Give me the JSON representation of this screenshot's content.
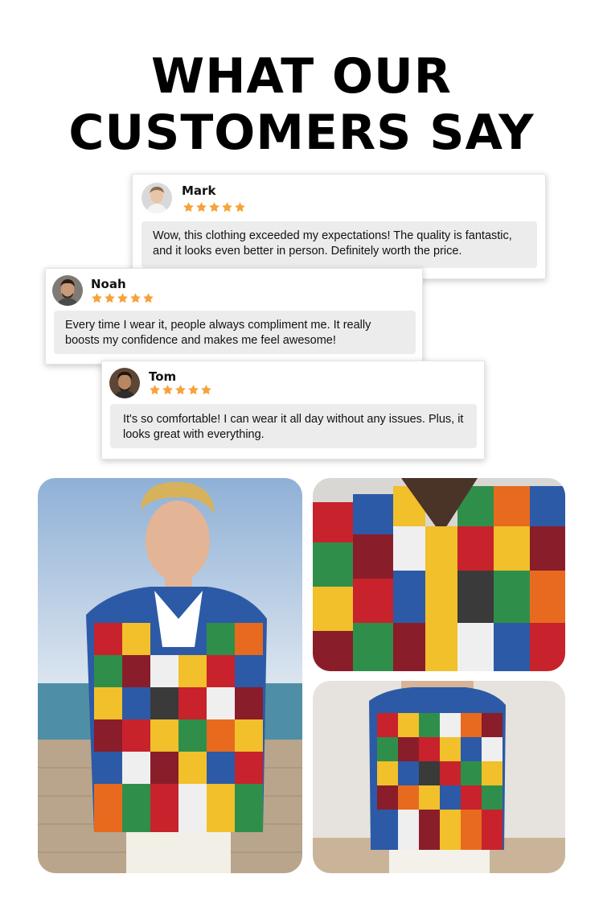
{
  "headline": {
    "line1": "WHAT OUR",
    "line2": "CUSTOMERS SAY"
  },
  "reviews": [
    {
      "name": "Mark",
      "rating": 5,
      "text": "Wow, this clothing exceeded my expectations! The quality is fantastic, and it looks even better in person. Definitely worth the price."
    },
    {
      "name": "Noah",
      "rating": 5,
      "text": "Every time I wear it, people always compliment me. It really boosts my confidence and makes me feel awesome!"
    },
    {
      "name": "Tom",
      "rating": 5,
      "text": "It's so comfortable! I can wear it all day without any issues. Plus, it looks great with everything."
    }
  ],
  "colors": {
    "star": "#f7a23a",
    "bubble": "#ececec",
    "headline": "#000000"
  },
  "icons": {
    "rating": "star-icon",
    "avatar": "avatar-photo"
  },
  "photos": [
    {
      "name": "model-full-photo",
      "subject": "man in patchwork shirt on beach deck"
    },
    {
      "name": "shirt-closeup-photo",
      "subject": "patchwork shirt close-up"
    },
    {
      "name": "shirt-studio-photo",
      "subject": "patchwork shirt studio shot"
    }
  ]
}
